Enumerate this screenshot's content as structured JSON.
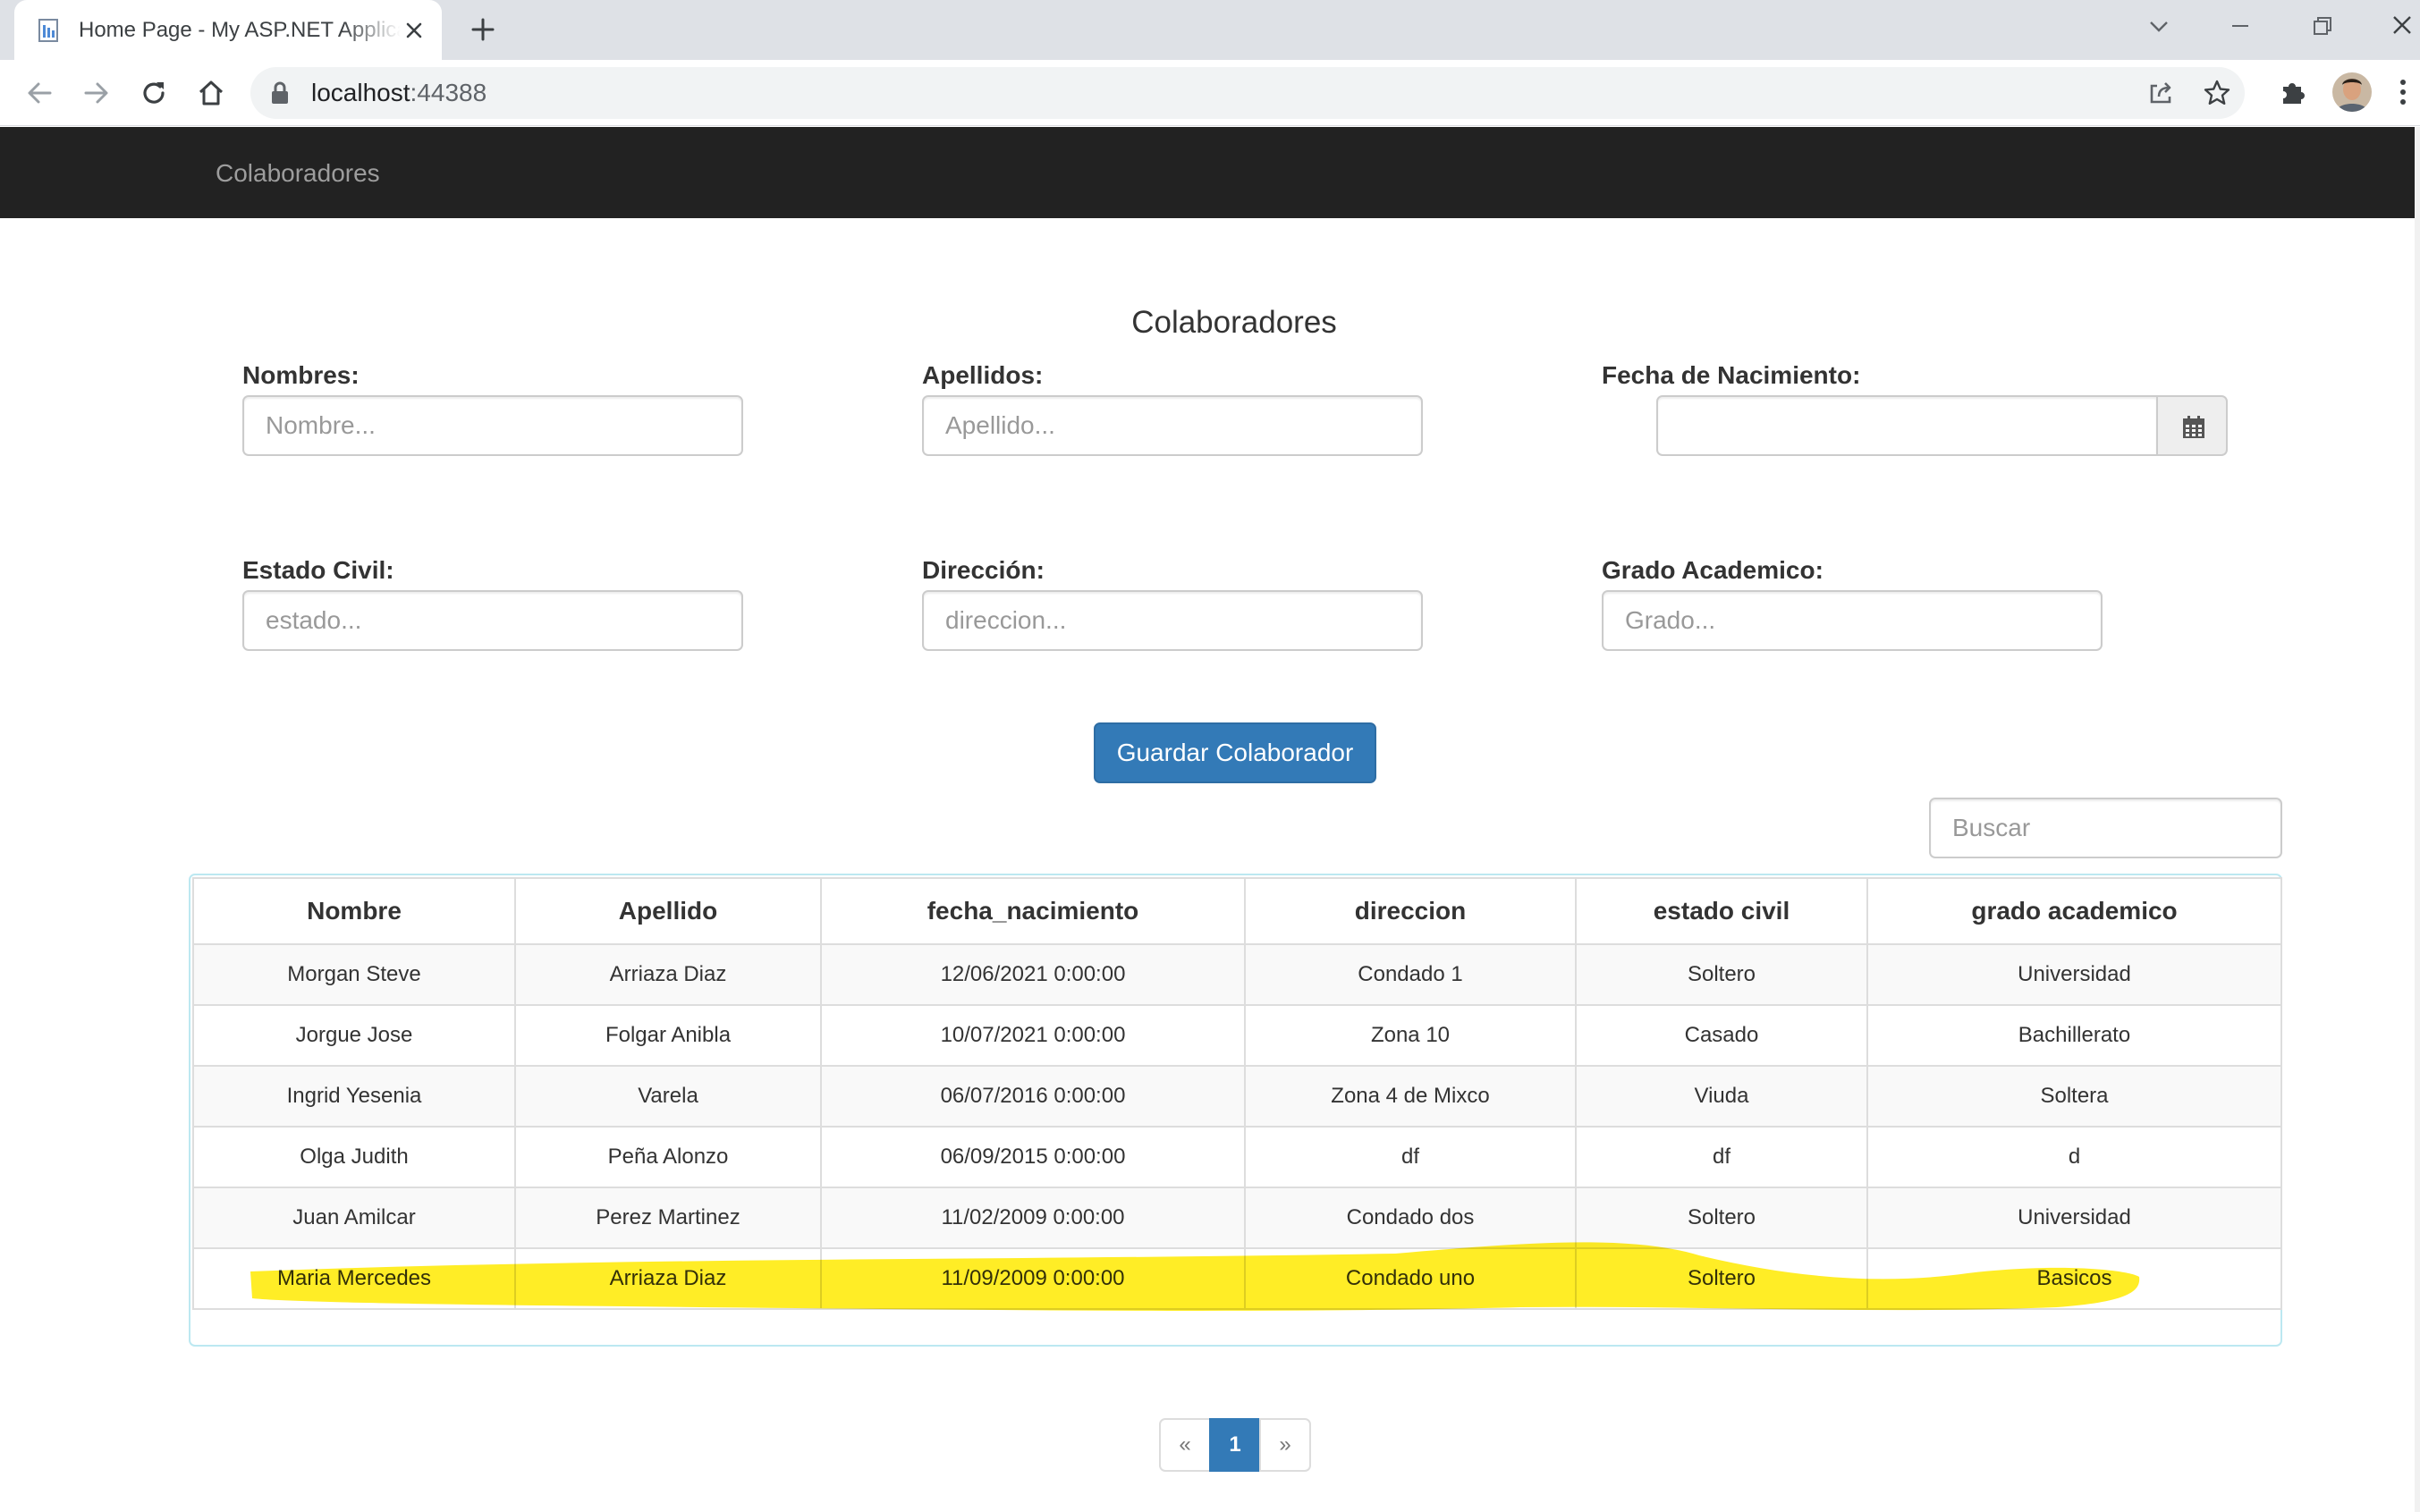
{
  "browser": {
    "tab_title": "Home Page - My ASP.NET Application",
    "url_host": "localhost",
    "url_port": ":44388"
  },
  "navbar": {
    "brand": "Colaboradores"
  },
  "form": {
    "title": "Colaboradores",
    "nombres": {
      "label": "Nombres:",
      "placeholder": "Nombre..."
    },
    "apellidos": {
      "label": "Apellidos:",
      "placeholder": "Apellido..."
    },
    "fecha": {
      "label": "Fecha de Nacimiento:",
      "value": ""
    },
    "estado": {
      "label": "Estado Civil:",
      "placeholder": "estado..."
    },
    "direccion": {
      "label": "Dirección:",
      "placeholder": "direccion..."
    },
    "grado": {
      "label": "Grado Academico:",
      "placeholder": "Grado..."
    },
    "save_label": "Guardar Colaborador"
  },
  "search": {
    "placeholder": "Buscar"
  },
  "table": {
    "headers": [
      "Nombre",
      "Apellido",
      "fecha_nacimiento",
      "direccion",
      "estado civil",
      "grado academico"
    ],
    "rows": [
      [
        "Morgan Steve",
        "Arriaza Diaz",
        "12/06/2021 0:00:00",
        "Condado 1",
        "Soltero",
        "Universidad"
      ],
      [
        "Jorgue Jose",
        "Folgar Anibla",
        "10/07/2021 0:00:00",
        "Zona 10",
        "Casado",
        "Bachillerato"
      ],
      [
        "Ingrid Yesenia",
        "Varela",
        "06/07/2016 0:00:00",
        "Zona 4 de Mixco",
        "Viuda",
        "Soltera"
      ],
      [
        "Olga Judith",
        "Peña Alonzo",
        "06/09/2015 0:00:00",
        "df",
        "df",
        "d"
      ],
      [
        "Juan Amilcar",
        "Perez Martinez",
        "11/02/2009 0:00:00",
        "Condado dos",
        "Soltero",
        "Universidad"
      ],
      [
        "Maria Mercedes",
        "Arriaza Diaz",
        "11/09/2009 0:00:00",
        "Condado uno",
        "Soltero",
        "Basicos"
      ]
    ]
  },
  "pagination": {
    "prev": "«",
    "current": "1",
    "next": "»"
  },
  "colors": {
    "navbar": "#222222",
    "primary": "#337ab7",
    "highlight": "#ffeb00",
    "table_border": "#bce8f1"
  }
}
